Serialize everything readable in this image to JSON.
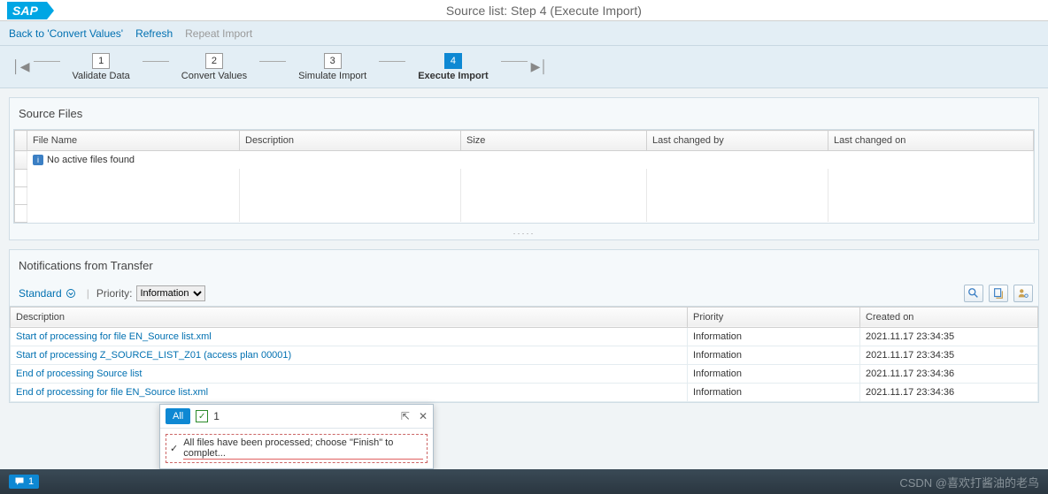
{
  "header": {
    "logo": "SAP",
    "title": "Source list: Step 4  (Execute Import)"
  },
  "toolbar": {
    "back_label": "Back to 'Convert Values'",
    "refresh_label": "Refresh",
    "repeat_label": "Repeat Import"
  },
  "wizard": {
    "steps": [
      {
        "num": "1",
        "label": "Validate Data"
      },
      {
        "num": "2",
        "label": "Convert Values"
      },
      {
        "num": "3",
        "label": "Simulate Import"
      },
      {
        "num": "4",
        "label": "Execute Import"
      }
    ],
    "active_index": 3
  },
  "source_files": {
    "title": "Source Files",
    "columns": [
      "File Name",
      "Description",
      "Size",
      "Last changed by",
      "Last changed on"
    ],
    "empty_message": "No active files found"
  },
  "notifications": {
    "title": "Notifications from Transfer",
    "standard_label": "Standard",
    "priority_label": "Priority:",
    "priority_value": "Information",
    "columns": [
      "Description",
      "Priority",
      "Created on"
    ],
    "rows": [
      {
        "desc": "Start of processing for file EN_Source list.xml",
        "prio": "Information",
        "created": "2021.11.17 23:34:35"
      },
      {
        "desc": "Start of processing Z_SOURCE_LIST_Z01 (access plan 00001)",
        "prio": "Information",
        "created": "2021.11.17 23:34:35"
      },
      {
        "desc": "End of processing Source list",
        "prio": "Information",
        "created": "2021.11.17 23:34:36"
      },
      {
        "desc": "End of processing for file EN_Source list.xml",
        "prio": "Information",
        "created": "2021.11.17 23:34:36"
      }
    ]
  },
  "popup": {
    "all_label": "All",
    "count": "1",
    "message": "All files have been processed; choose \"Finish\" to complet..."
  },
  "footer": {
    "badge_count": "1",
    "watermark": "CSDN @喜欢打酱油的老鸟"
  }
}
